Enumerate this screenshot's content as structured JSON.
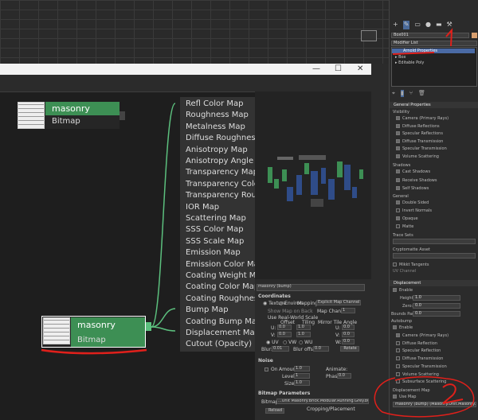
{
  "viewport": {},
  "slate": {
    "nodes": {
      "top_bitmap": {
        "title": "masonry (bump)",
        "subtitle": "Bitmap"
      },
      "bottom_bitmap": {
        "title": "masonry (bump)",
        "subtitle": "Bitmap"
      }
    },
    "slots": [
      {
        "label": "Refl Color Map",
        "connected": true
      },
      {
        "label": "Roughness Map",
        "connected": false
      },
      {
        "label": "Metalness Map",
        "connected": false
      },
      {
        "label": "Diffuse Roughness Map",
        "connected": false
      },
      {
        "label": "Anisotropy Map",
        "connected": false
      },
      {
        "label": "Anisotropy Angle Map",
        "connected": false
      },
      {
        "label": "Transparency Map",
        "connected": false
      },
      {
        "label": "Transparency Color Map",
        "connected": false
      },
      {
        "label": "Transparency Roughness Map",
        "connected": false
      },
      {
        "label": "IOR Map",
        "connected": false
      },
      {
        "label": "Scattering Map",
        "connected": false
      },
      {
        "label": "SSS Color Map",
        "connected": false
      },
      {
        "label": "SSS Scale Map",
        "connected": false
      },
      {
        "label": "Emission Map",
        "connected": false
      },
      {
        "label": "Emission Color Map",
        "connected": false
      },
      {
        "label": "Coating Weight Map",
        "connected": false
      },
      {
        "label": "Coating Color Map",
        "connected": false
      },
      {
        "label": "Coating Roughness Map",
        "connected": false
      },
      {
        "label": "Bump Map",
        "connected": true
      },
      {
        "label": "Coating Bump Map",
        "connected": false
      },
      {
        "label": "Displacement Map",
        "connected": true
      },
      {
        "label": "Cutout (Opacity) Map",
        "connected": false
      }
    ],
    "params": {
      "name": "masonry (bump)",
      "coordinates_header": "Coordinates",
      "texture": "Texture",
      "environ": "Environ",
      "mapping_label": "Mapping:",
      "mapping_value": "Explicit Map Channel",
      "show_map": "Show Map on Back",
      "map_channel_label": "Map Channel:",
      "map_channel": "1",
      "real_world": "Use Real-World Scale",
      "offset": "Offset",
      "tiling": "Tiling",
      "mirror_tile": "Mirror Tile",
      "angle": "Angle",
      "u": "U:",
      "v": "V:",
      "w": "W:",
      "u_offset": "0.0",
      "v_offset": "0.0",
      "u_tiling": "1.0",
      "v_tiling": "1.0",
      "u_angle": "0.0",
      "v_angle": "0.0",
      "w_angle": "0.0",
      "uv": "UV",
      "vw": "VW",
      "wu": "WU",
      "blur_label": "Blur:",
      "blur": "0.01",
      "blur_offset_label": "Blur offset:",
      "blur_offset": "0.0",
      "rotate": "Rotate",
      "noise_header": "Noise",
      "on": "On",
      "amount_label": "Amount:",
      "amount": "1.0",
      "animate": "Animate:",
      "levels_label": "Levels:",
      "levels": "1",
      "phase_label": "Phase:",
      "phase": "0.0",
      "size_label": "Size:",
      "size": "1.0",
      "bitmap_header": "Bitmap Parameters",
      "bitmap_label": "Bitmap:",
      "bitmap_path": "...Unit Masonry.Brick.Modular.Running.Grey.bump.jpg",
      "reload": "Reload",
      "cropping": "Cropping/Placement"
    }
  },
  "command_panel": {
    "object_name": "Box001",
    "modifier_list": "Modifier List",
    "stack": [
      "Arnold Properties",
      "Box",
      "Editable Poly"
    ],
    "general_properties": "General Properties",
    "visibility": "Visibility",
    "vis_items": [
      "Camera (Primary Rays)",
      "Diffuse Reflections",
      "Specular Reflections",
      "Diffuse Transmission",
      "Specular Transmission",
      "Volume Scattering"
    ],
    "shadows": "Shadows",
    "shadow_items": [
      "Cast Shadows",
      "Receive Shadows",
      "Self Shadows"
    ],
    "general": "General",
    "general_items": [
      "Double Sided",
      "Invert Normals",
      "Opaque",
      "Matte"
    ],
    "trace_sets": "Trace Sets",
    "cryptomatte": "Cryptomatte Asset",
    "mikkt": "Mikkt Tangents",
    "uv_channel": "UV Channel",
    "displacement": "Displacement",
    "enable": "Enable",
    "height_label": "Height:",
    "height": "1.0",
    "zero_label": "Zero:",
    "zero": "0.0",
    "bounds_label": "Bounds Pad:",
    "bounds": "0.0",
    "autobump": "Autobump",
    "autobump_enable": "Enable",
    "auto_items": [
      "Camera (Primary Rays)",
      "Diffuse Reflection",
      "Specular Reflection",
      "Diffuse Transmission",
      "Specular Transmission",
      "Volume Scattering",
      "Subsurface Scattering"
    ],
    "disp_map": "Displacement Map",
    "use_map": "Use Map",
    "disp_map_value": "masonry (bump) (Masonry.Unit.Masonry.Brick.Modul..."
  },
  "annotations": {
    "num1": "1",
    "num2": "2",
    "color": "#e0201b"
  },
  "colors": {
    "node_green": "#3d8f54",
    "wire_green": "#5cc07e"
  }
}
